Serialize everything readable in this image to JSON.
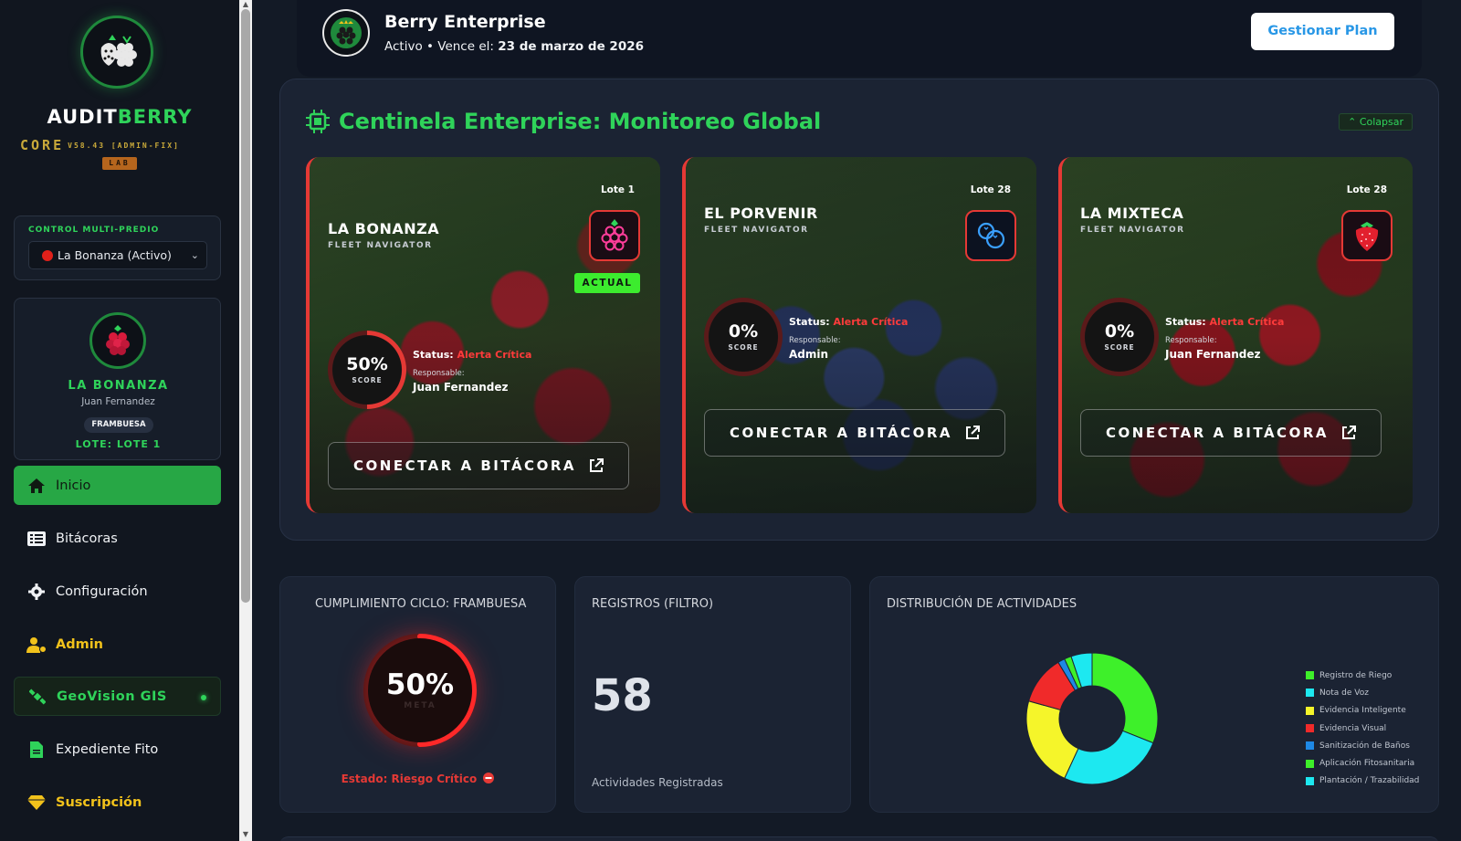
{
  "sidebar": {
    "brand_white": "AUDIT",
    "brand_green": "BERRY",
    "brand_sub": "CORE",
    "version": "V58.43 [ADMIN-FIX]",
    "lab": "LAB",
    "multi_label": "CONTROL MULTI-PREDIO",
    "multi_selected": "La Bonanza (Activo)",
    "farm": {
      "name": "LA BONANZA",
      "owner": "Juan Fernandez",
      "crop": "FRAMBUESA",
      "lote": "LOTE: LOTE 1"
    },
    "nav": [
      {
        "label": "Inicio",
        "icon": "home-icon"
      },
      {
        "label": "Bitácoras",
        "icon": "list-icon"
      },
      {
        "label": "Configuración",
        "icon": "gear-icon"
      },
      {
        "label": "Admin",
        "icon": "admin-user-icon"
      },
      {
        "label": "GeoVision GIS",
        "icon": "satellite-icon"
      },
      {
        "label": "Expediente Fito",
        "icon": "document-icon"
      },
      {
        "label": "Suscripción",
        "icon": "diamond-icon"
      }
    ]
  },
  "plan": {
    "title": "Berry Enterprise",
    "status_prefix": "Activo • Vence el: ",
    "expiry": "23 de marzo de 2026",
    "button": "Gestionar Plan"
  },
  "sentinel": {
    "title": "Centinela Enterprise: Monitoreo Global",
    "collapse": "Colapsar",
    "cards": [
      {
        "name": "LA BONANZA",
        "sub": "FLEET NAVIGATOR",
        "lote": "Lote 1",
        "fruit_icon": "raspberry-icon",
        "badge": "ACTUAL",
        "score": 50,
        "score_text": "50%",
        "score_label": "SCORE",
        "status_label": "Status: ",
        "status": "Alerta Crítica",
        "resp_label": "Responsable:",
        "responsable": "Juan Fernandez",
        "button": "CONECTAR A BITÁCORA"
      },
      {
        "name": "EL PORVENIR",
        "sub": "FLEET NAVIGATOR",
        "lote": "Lote 28",
        "fruit_icon": "blueberry-icon",
        "badge": "",
        "score": 0,
        "score_text": "0%",
        "score_label": "SCORE",
        "status_label": "Status: ",
        "status": "Alerta Crítica",
        "resp_label": "Responsable:",
        "responsable": "Admin",
        "button": "CONECTAR A BITÁCORA"
      },
      {
        "name": "LA MIXTECA",
        "sub": "FLEET NAVIGATOR",
        "lote": "Lote 28",
        "fruit_icon": "strawberry-icon",
        "badge": "",
        "score": 0,
        "score_text": "0%",
        "score_label": "SCORE",
        "status_label": "Status: ",
        "status": "Alerta Crítica",
        "resp_label": "Responsable:",
        "responsable": "Juan Fernandez",
        "button": "CONECTAR A BITÁCORA"
      }
    ]
  },
  "stats": {
    "compliance": {
      "title": "CUMPLIMIENTO CICLO: FRAMBUESA",
      "value": 50,
      "value_text": "50%",
      "sub": "META",
      "estado": "Estado: Riesgo Crítico"
    },
    "registros": {
      "title": "REGISTROS (FILTRO)",
      "count": "58",
      "label": "Actividades Registradas"
    },
    "distribucion": {
      "title": "DISTRIBUCIÓN DE ACTIVIDADES"
    }
  },
  "chart_data": {
    "type": "pie",
    "donut": true,
    "categories": [
      "Registro de Riego",
      "Nota de Voz",
      "Evidencia Inteligente",
      "Evidencia Visual",
      "Sanitización de Baños",
      "Aplicación Fitosanitaria",
      "Plantación / Trazabilidad"
    ],
    "values": [
      18,
      15,
      13,
      7,
      1,
      1,
      3
    ],
    "colors": [
      "#3ef02a",
      "#1de8f0",
      "#f5f52a",
      "#f02a2a",
      "#1e88e5",
      "#3ef02a",
      "#1de8f0"
    ],
    "legend": "right"
  }
}
